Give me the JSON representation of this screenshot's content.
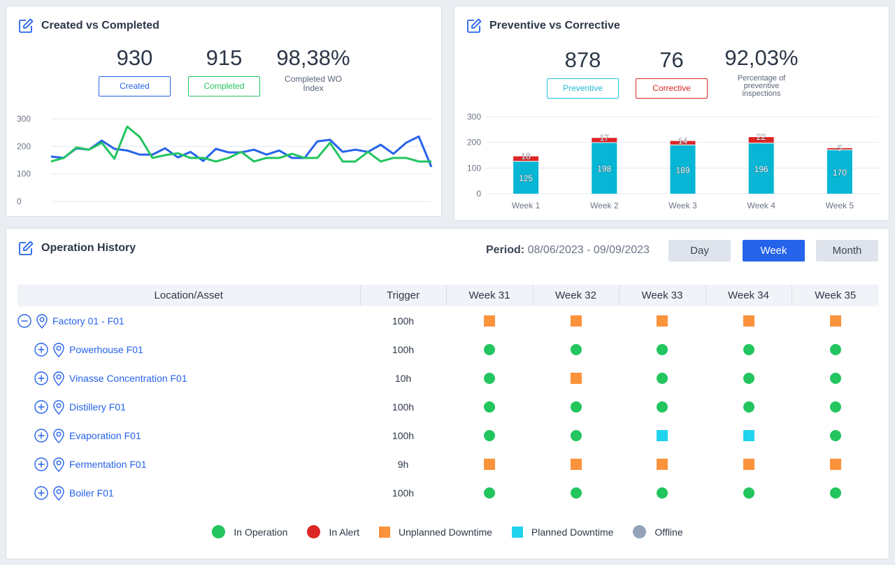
{
  "colors": {
    "primary": "#2563eb",
    "green": "#22c55e",
    "red": "#dc2626",
    "orange": "#fb923c",
    "cyan": "#22d3ee",
    "gray": "#94a3b8",
    "bar_preventive": "#06b6d4",
    "bar_corrective": "#dc2626"
  },
  "created_vs_completed": {
    "title": "Created vs Completed",
    "kpis": [
      {
        "value": "930",
        "label": "Created",
        "color": "#2563eb"
      },
      {
        "value": "915",
        "label": "Completed",
        "color": "#22c55e"
      },
      {
        "value": "98,38%",
        "caption": "Completed WO Index"
      }
    ]
  },
  "preventive_vs_corrective": {
    "title": "Preventive vs Corrective",
    "kpis": [
      {
        "value": "878",
        "label": "Preventive",
        "color": "#06b6d4"
      },
      {
        "value": "76",
        "label": "Corrective",
        "color": "#dc2626"
      },
      {
        "value": "92,03%",
        "caption": "Percentage of preventive inspections"
      }
    ]
  },
  "chart_data": [
    {
      "type": "line",
      "title": "Created vs Completed",
      "xlabel": "",
      "ylabel": "",
      "ylim": [
        0,
        300
      ],
      "yticks": [
        0,
        100,
        200,
        300
      ],
      "grid": true,
      "series": [
        {
          "name": "Created",
          "color": "#2563eb",
          "values": [
            163,
            158,
            193,
            188,
            221,
            191,
            185,
            170,
            170,
            193,
            160,
            180,
            147,
            191,
            178,
            178,
            188,
            170,
            185,
            158,
            158,
            218,
            224,
            180,
            188,
            180,
            206,
            173,
            213,
            236,
            125
          ]
        },
        {
          "name": "Completed",
          "color": "#22c55e",
          "values": [
            145,
            158,
            196,
            188,
            213,
            155,
            272,
            234,
            158,
            168,
            175,
            158,
            158,
            145,
            158,
            180,
            145,
            158,
            158,
            173,
            158,
            158,
            213,
            145,
            145,
            180,
            145,
            158,
            158,
            145,
            145
          ]
        }
      ]
    },
    {
      "type": "bar",
      "stacked": true,
      "title": "Preventive vs Corrective",
      "categories": [
        "Week 1",
        "Week 2",
        "Week 3",
        "Week 4",
        "Week 5"
      ],
      "ylim": [
        0,
        300
      ],
      "yticks": [
        0,
        100,
        200,
        300
      ],
      "grid": true,
      "series": [
        {
          "name": "Preventive",
          "color": "#06b6d4",
          "values": [
            125,
            198,
            189,
            196,
            170
          ]
        },
        {
          "name": "Corrective",
          "color": "#dc2626",
          "values": [
            18,
            17,
            14,
            22,
            5
          ]
        }
      ]
    }
  ],
  "operation_history": {
    "title": "Operation History",
    "period_label": "Period:",
    "period_value": "08/06/2023 - 09/09/2023",
    "buttons": {
      "day": "Day",
      "week": "Week",
      "month": "Month"
    },
    "active_button": "week",
    "columns": [
      "Location/Asset",
      "Trigger",
      "Week 31",
      "Week 32",
      "Week 33",
      "Week 34",
      "Week 35"
    ],
    "rows": [
      {
        "name": "Factory 01 - F01",
        "level": 0,
        "expanded": true,
        "trigger": "100h",
        "statuses": [
          "unplanned",
          "unplanned",
          "unplanned",
          "unplanned",
          "unplanned"
        ]
      },
      {
        "name": "Powerhouse F01",
        "level": 1,
        "expanded": false,
        "trigger": "100h",
        "statuses": [
          "operation",
          "operation",
          "operation",
          "operation",
          "operation"
        ]
      },
      {
        "name": "Vinasse Concentration F01",
        "level": 1,
        "expanded": false,
        "trigger": "10h",
        "statuses": [
          "operation",
          "unplanned",
          "operation",
          "operation",
          "operation"
        ]
      },
      {
        "name": "Distillery F01",
        "level": 1,
        "expanded": false,
        "trigger": "100h",
        "statuses": [
          "operation",
          "operation",
          "operation",
          "operation",
          "operation"
        ]
      },
      {
        "name": "Evaporation F01",
        "level": 1,
        "expanded": false,
        "trigger": "100h",
        "statuses": [
          "operation",
          "operation",
          "planned",
          "planned",
          "operation"
        ]
      },
      {
        "name": "Fermentation F01",
        "level": 1,
        "expanded": false,
        "trigger": "9h",
        "statuses": [
          "unplanned",
          "unplanned",
          "unplanned",
          "unplanned",
          "unplanned"
        ]
      },
      {
        "name": "Boiler F01",
        "level": 1,
        "expanded": false,
        "trigger": "100h",
        "statuses": [
          "operation",
          "operation",
          "operation",
          "operation",
          "operation"
        ]
      }
    ],
    "legend": [
      {
        "key": "operation",
        "label": "In Operation",
        "shape": "circle",
        "color": "#22c55e"
      },
      {
        "key": "alert",
        "label": "In Alert",
        "shape": "circle",
        "color": "#dc2626"
      },
      {
        "key": "unplanned",
        "label": "Unplanned Downtime",
        "shape": "square",
        "color": "#fb923c"
      },
      {
        "key": "planned",
        "label": "Planned Downtime",
        "shape": "square",
        "color": "#22d3ee"
      },
      {
        "key": "offline",
        "label": "Offline",
        "shape": "circle",
        "color": "#94a3b8"
      }
    ]
  }
}
